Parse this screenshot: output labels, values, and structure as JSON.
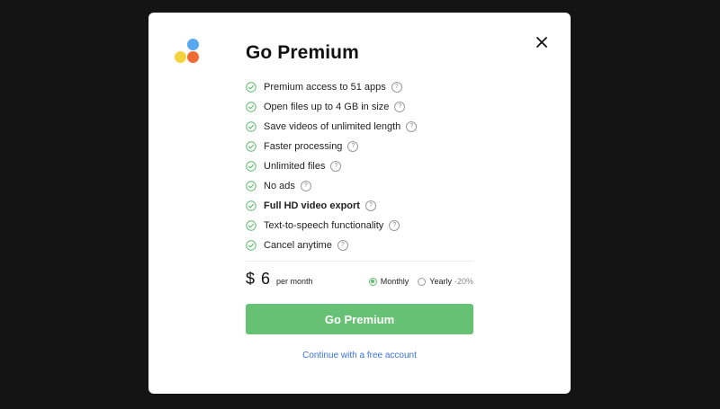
{
  "modal": {
    "title": "Go Premium",
    "features": [
      {
        "label": "Premium access to 51 apps",
        "bold": false
      },
      {
        "label": "Open files up to 4 GB in size",
        "bold": false
      },
      {
        "label": "Save videos of unlimited length",
        "bold": false
      },
      {
        "label": "Faster processing",
        "bold": false
      },
      {
        "label": "Unlimited files",
        "bold": false
      },
      {
        "label": "No ads",
        "bold": false
      },
      {
        "label": "Full HD video export",
        "bold": true
      },
      {
        "label": "Text-to-speech functionality",
        "bold": false
      },
      {
        "label": "Cancel anytime",
        "bold": false
      }
    ],
    "help_glyph": "?",
    "price": {
      "amount": "$ 6",
      "period": "per month"
    },
    "billing": {
      "monthly_label": "Monthly",
      "yearly_label": "Yearly",
      "yearly_discount": "-20%",
      "selected": "monthly"
    },
    "cta_label": "Go Premium",
    "free_link": "Continue with a free account"
  },
  "colors": {
    "backdrop": "#141414",
    "accent_green": "#67c174",
    "link_blue": "#3b73e0",
    "logo_blue": "#58a7f2",
    "logo_yellow": "#f4d33c",
    "logo_orange": "#ef6c35"
  },
  "icons": {
    "logo": "three-dots-logo",
    "close": "close-icon",
    "check": "check-circle-icon",
    "help": "help-circle-icon"
  }
}
